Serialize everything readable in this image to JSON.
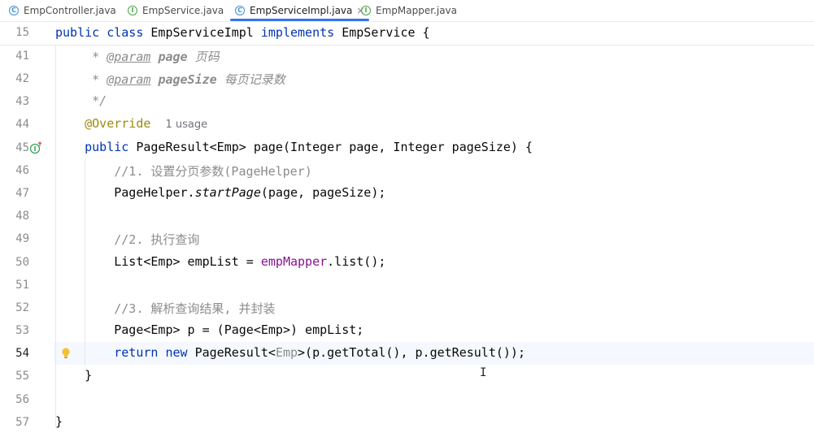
{
  "tabs": [
    {
      "label": "EmpController.java",
      "icon": "class-icon",
      "active": false
    },
    {
      "label": "EmpService.java",
      "icon": "interface-icon",
      "active": false
    },
    {
      "label": "EmpServiceImpl.java",
      "icon": "class-icon",
      "active": true
    },
    {
      "label": "EmpMapper.java",
      "icon": "interface-icon",
      "active": false
    }
  ],
  "icon_glyphs": {
    "class": "C",
    "interface": "I",
    "close": "×"
  },
  "editor": {
    "sticky": {
      "line": "15",
      "text": "public class EmpServiceImpl implements EmpService {"
    },
    "lines": [
      {
        "n": "41",
        "text": "     * @param page 页码"
      },
      {
        "n": "42",
        "text": "     * @param pageSize 每页记录数"
      },
      {
        "n": "43",
        "text": "     */"
      },
      {
        "n": "44",
        "text": "    @Override  1 usage"
      },
      {
        "n": "45",
        "text": "    public PageResult<Emp> page(Integer page, Integer pageSize) {"
      },
      {
        "n": "46",
        "text": "        //1. 设置分页参数(PageHelper)"
      },
      {
        "n": "47",
        "text": "        PageHelper.startPage(page, pageSize);"
      },
      {
        "n": "48",
        "text": ""
      },
      {
        "n": "49",
        "text": "        //2. 执行查询"
      },
      {
        "n": "50",
        "text": "        List<Emp> empList = empMapper.list();"
      },
      {
        "n": "51",
        "text": ""
      },
      {
        "n": "52",
        "text": "        //3. 解析查询结果, 并封装"
      },
      {
        "n": "53",
        "text": "        Page<Emp> p = (Page<Emp>) empList;"
      },
      {
        "n": "54",
        "text": "        return new PageResult<Emp>(p.getTotal(), p.getResult());"
      },
      {
        "n": "55",
        "text": "    }"
      },
      {
        "n": "56",
        "text": ""
      },
      {
        "n": "57",
        "text": "}"
      }
    ],
    "usage_hint": "1 usage",
    "cursor": "I"
  },
  "colors": {
    "keyword": "#0033b3",
    "comment": "#8c8c8c",
    "annotation": "#9e880d",
    "field": "#871094",
    "active_tab_underline": "#3574f0",
    "current_line": "#f5f8fe"
  }
}
